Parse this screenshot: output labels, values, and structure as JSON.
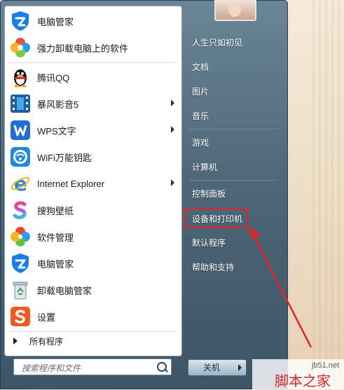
{
  "left_panel": {
    "programs": [
      {
        "label": "电脑管家",
        "icon": "tencent-pc-manager-icon",
        "arrow": false
      },
      {
        "label": "强力卸载电脑上的软件",
        "icon": "uninstall-flower-icon",
        "arrow": false
      },
      {
        "label": "腾讯QQ",
        "icon": "qq-penguin-icon",
        "arrow": false
      },
      {
        "label": "暴风影音5",
        "icon": "baofeng-film-icon",
        "arrow": true
      },
      {
        "label": "WPS文字",
        "icon": "wps-writer-icon",
        "arrow": true
      },
      {
        "label": "WiFi万能钥匙",
        "icon": "wifi-key-icon",
        "arrow": false
      },
      {
        "label": "Internet Explorer",
        "icon": "internet-explorer-icon",
        "arrow": true
      },
      {
        "label": "搜狗壁纸",
        "icon": "sogou-wallpaper-icon",
        "arrow": false
      },
      {
        "label": "软件管理",
        "icon": "software-manager-icon",
        "arrow": false
      },
      {
        "label": "电脑管家",
        "icon": "tencent-pc-manager-icon",
        "arrow": false
      },
      {
        "label": "卸载电脑管家",
        "icon": "recycle-bin-icon",
        "arrow": false
      },
      {
        "label": "设置",
        "icon": "sogou-settings-icon",
        "arrow": false
      }
    ],
    "all_programs": "所有程序",
    "search_placeholder": "搜索程序和文件"
  },
  "right_panel": {
    "items": [
      "人生只如初见",
      "文档",
      "图片",
      "音乐",
      "游戏",
      "计算机",
      "控制面板",
      "设备和打印机",
      "默认程序",
      "帮助和支持"
    ],
    "highlighted_item": "设备和打印机",
    "shutdown_label": "关机"
  },
  "watermark": {
    "url": "jb51.net",
    "name": "脚本之家"
  },
  "colors": {
    "highlight_border": "#e2252a",
    "menu_blue": "#4c6577"
  }
}
